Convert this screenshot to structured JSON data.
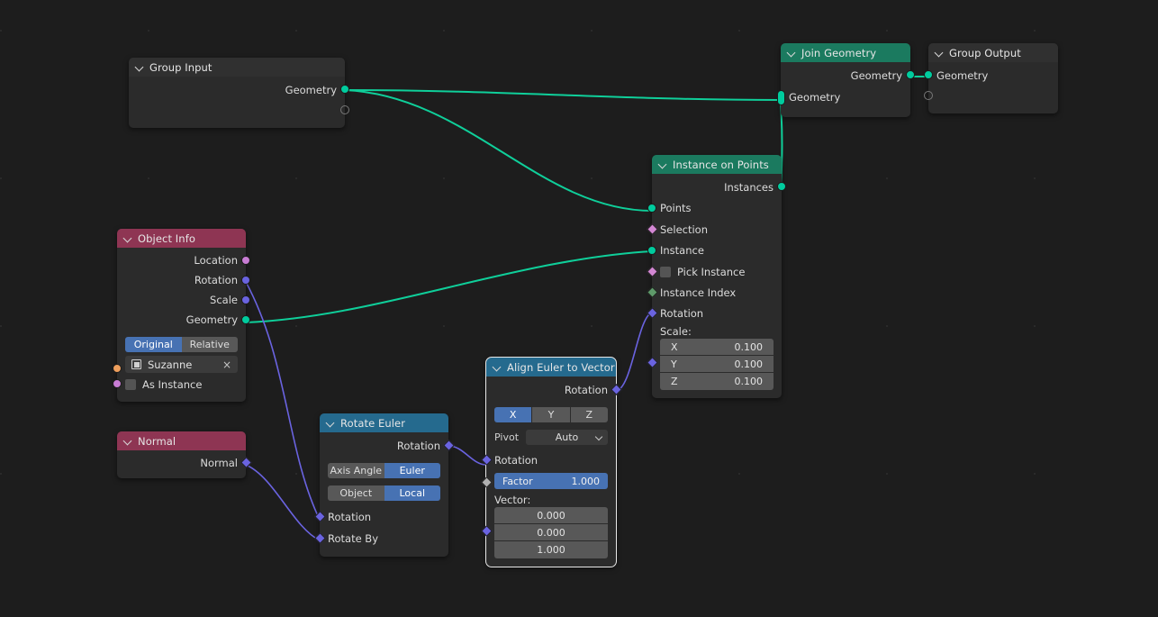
{
  "editor": {
    "name": "Geometry Node Editor",
    "background": "#1d1d1d"
  },
  "colors": {
    "geometry_socket": "#00cc9e",
    "vector_socket": "#6a63e0",
    "boolean_socket": "#d387d3",
    "integer_socket": "#5e9a6a",
    "float_socket": "#b0b0b0",
    "object_socket": "#ed9e5c",
    "header_geometry": "#1b7a5f",
    "header_input": "#303030",
    "header_object": "#8e3553",
    "header_vector": "#256a8e",
    "accent_blue": "#4772b3"
  },
  "nodes": {
    "group_input": {
      "title": "Group Input",
      "outputs": [
        {
          "label": "Geometry",
          "type": "geometry"
        },
        {
          "label": "",
          "type": "virtual"
        }
      ]
    },
    "join_geometry": {
      "title": "Join Geometry",
      "outputs": [
        {
          "label": "Geometry",
          "type": "geometry"
        }
      ],
      "inputs": [
        {
          "label": "Geometry",
          "type": "geometry-multi"
        }
      ]
    },
    "group_output": {
      "title": "Group Output",
      "inputs": [
        {
          "label": "Geometry",
          "type": "geometry"
        },
        {
          "label": "",
          "type": "virtual"
        }
      ]
    },
    "instance_on_points": {
      "title": "Instance on Points",
      "outputs": [
        {
          "label": "Instances",
          "type": "geometry"
        }
      ],
      "inputs": [
        {
          "label": "Points",
          "type": "geometry"
        },
        {
          "label": "Selection",
          "type": "boolean"
        },
        {
          "label": "Instance",
          "type": "geometry"
        },
        {
          "label": "Pick Instance",
          "type": "boolean",
          "checkbox": false
        },
        {
          "label": "Instance Index",
          "type": "integer"
        },
        {
          "label": "Rotation",
          "type": "vector"
        }
      ],
      "scale_label": "Scale:",
      "scale": [
        {
          "axis": "X",
          "value": "0.100"
        },
        {
          "axis": "Y",
          "value": "0.100"
        },
        {
          "axis": "Z",
          "value": "0.100"
        }
      ]
    },
    "object_info": {
      "title": "Object Info",
      "outputs": [
        {
          "label": "Location",
          "type": "vector"
        },
        {
          "label": "Rotation",
          "type": "vector"
        },
        {
          "label": "Scale",
          "type": "vector"
        },
        {
          "label": "Geometry",
          "type": "geometry"
        }
      ],
      "transform_space": {
        "options": [
          "Original",
          "Relative"
        ],
        "selected": "Original"
      },
      "object_field": {
        "value": "Suzanne",
        "clear_label": "×",
        "icon": "object-data-icon"
      },
      "as_instance": {
        "label": "As Instance",
        "checked": false
      }
    },
    "normal": {
      "title": "Normal",
      "outputs": [
        {
          "label": "Normal",
          "type": "vector"
        }
      ]
    },
    "rotate_euler": {
      "title": "Rotate Euler",
      "outputs": [
        {
          "label": "Rotation",
          "type": "vector"
        }
      ],
      "type_toggle": {
        "options": [
          "Axis Angle",
          "Euler"
        ],
        "selected": "Euler"
      },
      "space_toggle": {
        "options": [
          "Object",
          "Local"
        ],
        "selected": "Local"
      },
      "inputs": [
        {
          "label": "Rotation",
          "type": "vector"
        },
        {
          "label": "Rotate By",
          "type": "vector"
        }
      ]
    },
    "align_euler_to_vector": {
      "title": "Align Euler to Vector",
      "selected": true,
      "outputs": [
        {
          "label": "Rotation",
          "type": "vector"
        }
      ],
      "axis_toggle": {
        "options": [
          "X",
          "Y",
          "Z"
        ],
        "selected": "X"
      },
      "pivot": {
        "label": "Pivot",
        "value": "Auto"
      },
      "inputs": [
        {
          "label": "Rotation",
          "type": "vector"
        }
      ],
      "factor": {
        "label": "Factor",
        "value": "1.000"
      },
      "vector_label": "Vector:",
      "vector": [
        "0.000",
        "0.000",
        "1.000"
      ]
    }
  }
}
